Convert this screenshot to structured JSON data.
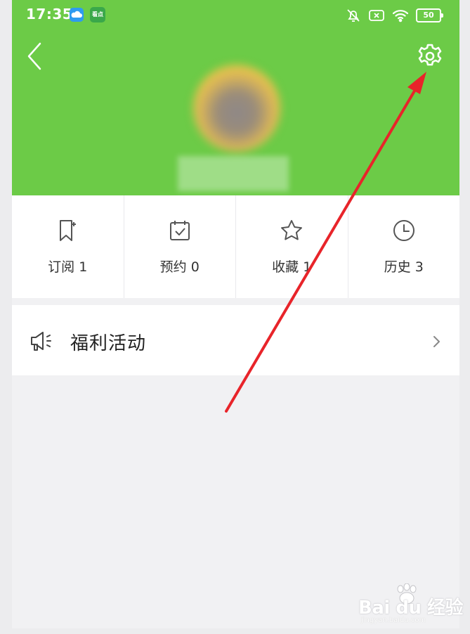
{
  "status_bar": {
    "time": "17:35",
    "app2_label": "看点",
    "battery": "50",
    "icons": [
      "cloud-app-icon",
      "kandian-app-icon",
      "bell-off-icon",
      "sim-off-icon",
      "wifi-icon",
      "battery-icon"
    ]
  },
  "header": {
    "back_icon": "chevron-left-icon",
    "settings_icon": "gear-icon",
    "accent_color": "#6ccb47"
  },
  "stats": [
    {
      "label": "订阅",
      "value": "1",
      "icon": "bookmark-plus-icon"
    },
    {
      "label": "预约",
      "value": "0",
      "icon": "calendar-check-icon"
    },
    {
      "label": "收藏",
      "value": "1",
      "icon": "star-icon"
    },
    {
      "label": "历史",
      "value": "3",
      "icon": "clock-icon"
    }
  ],
  "promo": {
    "title": "福利活动",
    "icon": "megaphone-icon"
  },
  "watermark": {
    "brand": "Bai du 经验",
    "url": "jingyan.baidu.com"
  },
  "annotation": {
    "color": "#e8242a"
  }
}
